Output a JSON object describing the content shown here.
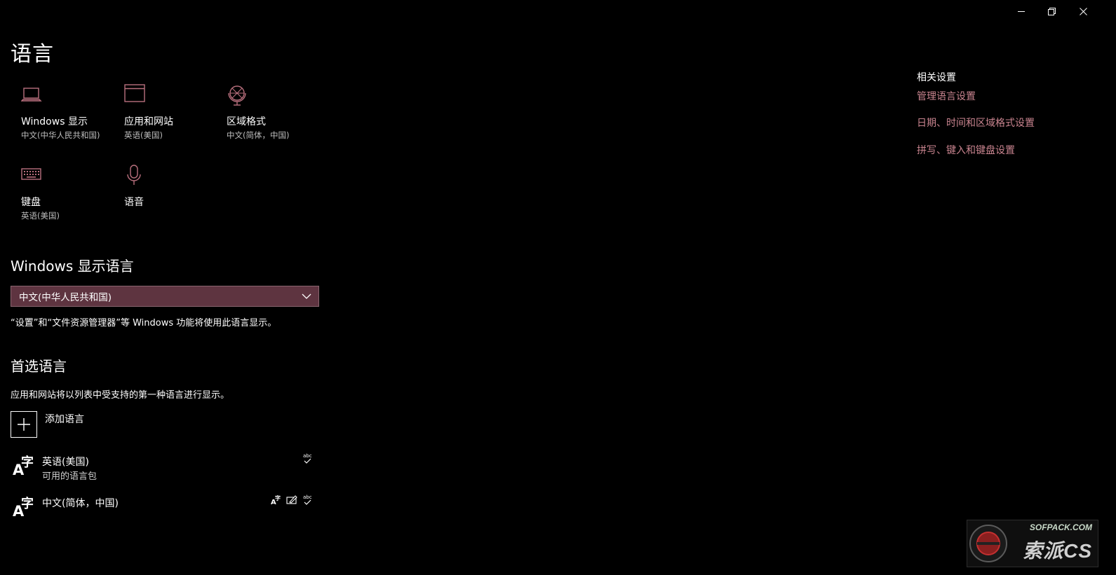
{
  "window": {
    "minimize_icon": "minimize-icon",
    "restore_icon": "restore-icon",
    "close_icon": "close-icon"
  },
  "page": {
    "title": "语言"
  },
  "tiles": [
    {
      "icon": "laptop-icon",
      "name": "Windows 显示",
      "sub": "中文(中华人民共和国)"
    },
    {
      "icon": "browser-window-icon",
      "name": "应用和网站",
      "sub": "英语(美国)"
    },
    {
      "icon": "globe-icon",
      "name": "区域格式",
      "sub": "中文(简体，中国)"
    },
    {
      "icon": "keyboard-icon",
      "name": "键盘",
      "sub": "英语(美国)"
    },
    {
      "icon": "microphone-icon",
      "name": "语音",
      "sub": ""
    }
  ],
  "display_language": {
    "heading": "Windows 显示语言",
    "selected": "中文(中华人民共和国)",
    "note": "“设置”和“文件资源管理器”等 Windows 功能将使用此语言显示。"
  },
  "preferred": {
    "heading": "首选语言",
    "note": "应用和网站将以列表中受支持的第一种语言进行显示。",
    "add_label": "添加语言",
    "languages": [
      {
        "name": "英语(美国)",
        "sub": "可用的语言包",
        "features": [
          "spellcheck-icon"
        ]
      },
      {
        "name": "中文(简体，中国)",
        "sub": "",
        "features": [
          "display-language-icon",
          "handwriting-icon",
          "spellcheck-icon"
        ]
      }
    ]
  },
  "related": {
    "title": "相关设置",
    "links": [
      "管理语言设置",
      "日期、时间和区域格式设置",
      "拼写、键入和键盘设置"
    ]
  },
  "colors": {
    "accent": "#c9848f",
    "icon_accent": "#b86f7d",
    "dropdown_bg": "#5e3440"
  },
  "watermark": {
    "line1": "SOFPACK.COM",
    "line2": "索派CS"
  }
}
